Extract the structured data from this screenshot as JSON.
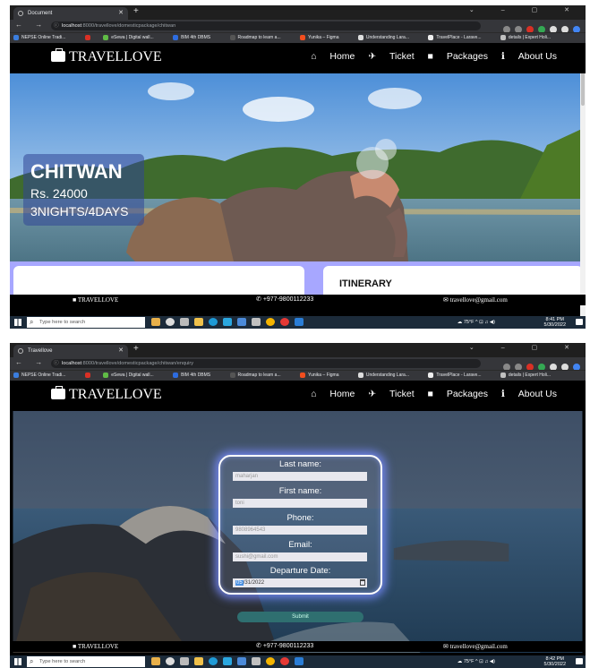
{
  "screenshot1": {
    "browser": {
      "tab_title": "Document",
      "url_host": "localhost",
      "url_path": ":8000/travellove/domesticpackage/chitwan"
    },
    "bookmarks": [
      "NEPSE Online Tradi...",
      "eSewa | Digital wall...",
      "BIM 4th DBMS",
      "Roadmap to learn a...",
      "Yunika – Figma",
      "Understanding Lara...",
      "TravelPlace - Larave...",
      "details | Expert Holi..."
    ],
    "site": {
      "brand": "TRAVELLOVE",
      "nav": [
        "Home",
        "Ticket",
        "Packages",
        "About Us"
      ],
      "destination": "CHITWAN",
      "price": "Rs. 24000",
      "duration": "3NIGHTS/4DAYS",
      "itinerary_heading": "ITINERARY"
    },
    "footer": {
      "brand": "TRAVELLOVE",
      "phone": "+977-9800112233",
      "email": "travellove@gmail.com"
    },
    "taskbar": {
      "search_placeholder": "Type here to search",
      "weather": "75°F",
      "time": "8:41 PM",
      "date": "5/30/2022"
    }
  },
  "screenshot2": {
    "browser": {
      "tab_title": "Travellove",
      "url_host": "localhost",
      "url_path": ":8000/travellove/domesticpackage/chitwan/enquiry"
    },
    "site": {
      "brand": "TRAVELLOVE",
      "nav": [
        "Home",
        "Ticket",
        "Packages",
        "About Us"
      ]
    },
    "form": {
      "last_name_label": "Last name:",
      "last_name_value": "maharjan",
      "first_name_label": "First name:",
      "first_name_value": "toni",
      "phone_label": "Phone:",
      "phone_value": "9808964543",
      "email_label": "Email:",
      "email_value": "sushi@gmail.com",
      "departure_label": "Departure Date:",
      "departure_month": "05",
      "departure_rest": "/31/2022",
      "submit_label": "Submit"
    },
    "footer": {
      "brand": "TRAVELLOVE",
      "phone": "+977-9800112233",
      "email": "travellove@gmail.com"
    },
    "taskbar": {
      "search_placeholder": "Type here to search",
      "weather": "75°F",
      "time": "8:42 PM",
      "date": "5/30/2022"
    }
  }
}
